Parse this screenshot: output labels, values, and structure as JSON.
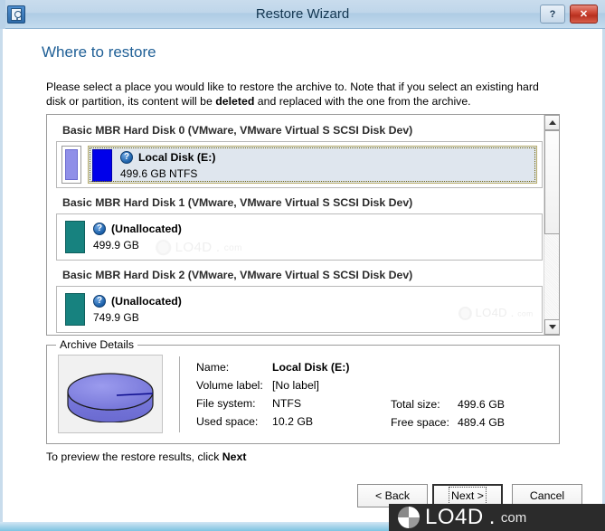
{
  "window": {
    "title": "Restore Wizard",
    "icon": "disk-drive-icon",
    "help_label": "?",
    "close_label": "✕"
  },
  "page": {
    "title": "Where to restore",
    "intro_part1": "Please select a place you would like to restore the archive to. Note that if you select an existing hard disk or partition, its content will be ",
    "intro_bold": "deleted",
    "intro_part2": " and replaced with the one from the archive.",
    "hint_prefix": "To preview the restore results, click ",
    "hint_bold": "Next"
  },
  "disk_list": {
    "scroll_thumb_percent": 55,
    "groups": [
      {
        "caption": "Basic MBR Hard Disk 0 (VMware, VMware Virtual S SCSI Disk Dev)",
        "selected": true,
        "partition": {
          "name": "Local Disk (E:)",
          "sub": "499.6 GB NTFS",
          "swatch_color": "#0000ea",
          "swatch_kind": "blue",
          "icon": "info-icon"
        }
      },
      {
        "caption": "Basic MBR Hard Disk 1 (VMware, VMware Virtual S SCSI Disk Dev)",
        "selected": false,
        "partition": {
          "name": "(Unallocated)",
          "sub": "499.9 GB",
          "swatch_color": "#17827f",
          "swatch_kind": "teal",
          "icon": "info-icon"
        }
      },
      {
        "caption": "Basic MBR Hard Disk 2 (VMware, VMware Virtual S SCSI Disk Dev)",
        "selected": false,
        "partition": {
          "name": "(Unallocated)",
          "sub": "749.9 GB",
          "swatch_color": "#17827f",
          "swatch_kind": "teal",
          "icon": "info-icon"
        }
      }
    ]
  },
  "details": {
    "legend": "Archive Details",
    "left": [
      {
        "label": "Name:",
        "value": "Local Disk (E:)",
        "bold": true
      },
      {
        "label": "Volume label:",
        "value": "[No label]",
        "bold": false
      },
      {
        "label": "File system:",
        "value": "NTFS",
        "bold": false
      },
      {
        "label": "Used space:",
        "value": "10.2 GB",
        "bold": false
      }
    ],
    "right": [
      {
        "label": "Total size:",
        "value": "499.6 GB"
      },
      {
        "label": "Free space:",
        "value": "489.4 GB"
      }
    ]
  },
  "buttons": {
    "back": "< Back",
    "next": "Next >",
    "cancel": "Cancel"
  },
  "watermark": {
    "text": "LO4D",
    "suffix": "com",
    "dot": "."
  },
  "colors": {
    "accent": "#1f5f96",
    "title_bar": "#bfd6ea",
    "selected_row": "#dfe6ee",
    "selection_border": "#b9ad6b",
    "partition_blue": "#0000ea",
    "unallocated_teal": "#17827f",
    "close_button": "#cf4a38"
  }
}
